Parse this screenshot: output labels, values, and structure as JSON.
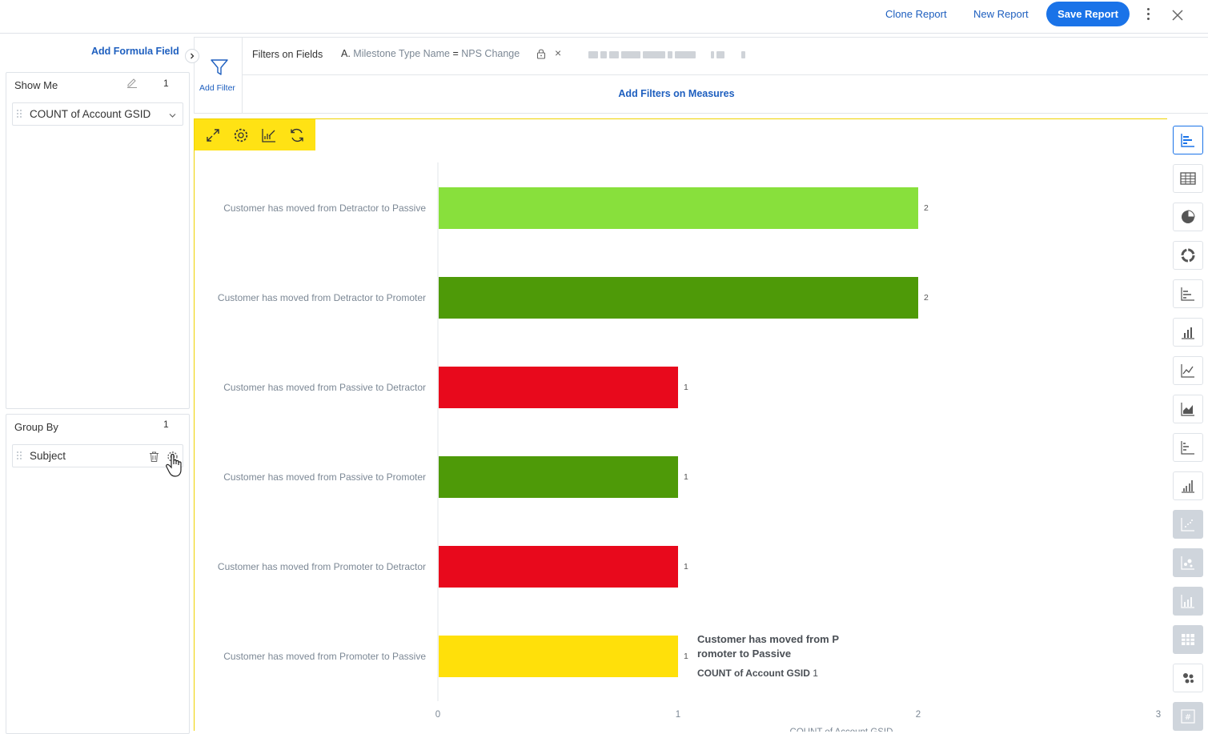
{
  "header": {
    "clone_label": "Clone Report",
    "new_label": "New Report",
    "save_label": "Save Report"
  },
  "left": {
    "formula_link": "Add Formula Field",
    "show_me": {
      "title": "Show Me",
      "count": "1",
      "item": "COUNT of Account GSID"
    },
    "group_by": {
      "title": "Group By",
      "count": "1",
      "item": "Subject"
    }
  },
  "filters": {
    "add_filter_label": "Add Filter",
    "fields_label": "Filters on Fields",
    "chip_prefix": "A.",
    "chip_field": "Milestone Type Name",
    "chip_op": "=",
    "chip_value": "NPS Change",
    "measures_link": "Add Filters on Measures"
  },
  "chart_data": {
    "type": "bar",
    "orientation": "horizontal",
    "categories": [
      "Customer has moved from Detractor to Passive",
      "Customer has moved from Detractor to Promoter",
      "Customer has moved from Passive to Detractor",
      "Customer has moved from Passive to Promoter",
      "Customer has moved from Promoter to Detractor",
      "Customer has moved from Promoter to Passive"
    ],
    "values": [
      2,
      2,
      1,
      1,
      1,
      1
    ],
    "bar_colors": [
      "#88e03c",
      "#4e9a08",
      "#e8091c",
      "#4e9a08",
      "#e8091c",
      "#ffe00a"
    ],
    "data_labels": [
      "2",
      "2",
      "1",
      "1",
      "1",
      "1"
    ],
    "xlim": [
      0,
      3
    ],
    "x_ticks": [
      "0",
      "1",
      "2",
      "3"
    ],
    "xlabel": "COUNT of Account GSID",
    "ylabel": "",
    "grid": false
  },
  "tooltip": {
    "title": "Customer has moved from Promoter to Passive",
    "measure": "COUNT of Account GSID",
    "value": "1"
  },
  "icons": {
    "chart_toolbar": [
      "expand-icon",
      "settings-icon",
      "chart-edit-icon",
      "refresh-icon"
    ],
    "chart_types": [
      "horizontal-bar-icon",
      "table-icon",
      "pie-icon",
      "donut-icon",
      "stacked-bar-icon",
      "column-icon",
      "line-icon",
      "area-icon",
      "stacked-column-icon",
      "grouped-column-icon",
      "scatter-icon",
      "bubble-icon",
      "combo-icon",
      "heatmap-icon",
      "packed-bubble-icon",
      "kpi-icon"
    ]
  },
  "colors": {
    "accent": "#1a73e8",
    "toolbar_yellow": "#ffe214",
    "link_blue": "#1e5fbf"
  }
}
